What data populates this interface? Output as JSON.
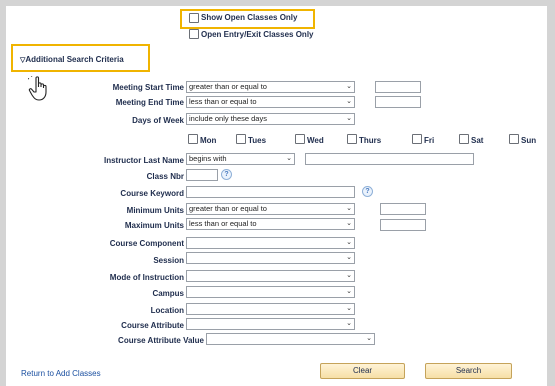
{
  "checkboxes_top": {
    "open_only": "Show Open Classes Only",
    "open_entry": "Open Entry/Exit Classes Only"
  },
  "section": {
    "toggle_icon": "triangle-down-icon",
    "title": "Additional Search Criteria"
  },
  "fields": {
    "meeting_start": {
      "label": "Meeting Start Time",
      "operator": "greater than or equal to"
    },
    "meeting_end": {
      "label": "Meeting End Time",
      "operator": "less than or equal to"
    },
    "days_of_week": {
      "label": "Days of Week",
      "operator": "include only these days"
    },
    "days": [
      "Mon",
      "Tues",
      "Wed",
      "Thurs",
      "Fri",
      "Sat",
      "Sun"
    ],
    "instructor": {
      "label": "Instructor Last Name",
      "operator": "begins with"
    },
    "class_nbr": {
      "label": "Class Nbr"
    },
    "course_keyword": {
      "label": "Course Keyword"
    },
    "min_units": {
      "label": "Minimum Units",
      "operator": "greater than or equal to"
    },
    "max_units": {
      "label": "Maximum Units",
      "operator": "less than or equal to"
    },
    "course_component": {
      "label": "Course Component"
    },
    "session": {
      "label": "Session"
    },
    "mode": {
      "label": "Mode of Instruction"
    },
    "campus": {
      "label": "Campus"
    },
    "location": {
      "label": "Location"
    },
    "course_attribute": {
      "label": "Course Attribute"
    },
    "course_attribute_value": {
      "label": "Course Attribute Value"
    }
  },
  "footer": {
    "return_link": "Return to Add Classes",
    "clear": "Clear",
    "search": "Search"
  },
  "colors": {
    "highlight": "#f0b400",
    "button": "#f6dfa6",
    "label": "#1f2d4d",
    "link": "#1a4fa0"
  }
}
